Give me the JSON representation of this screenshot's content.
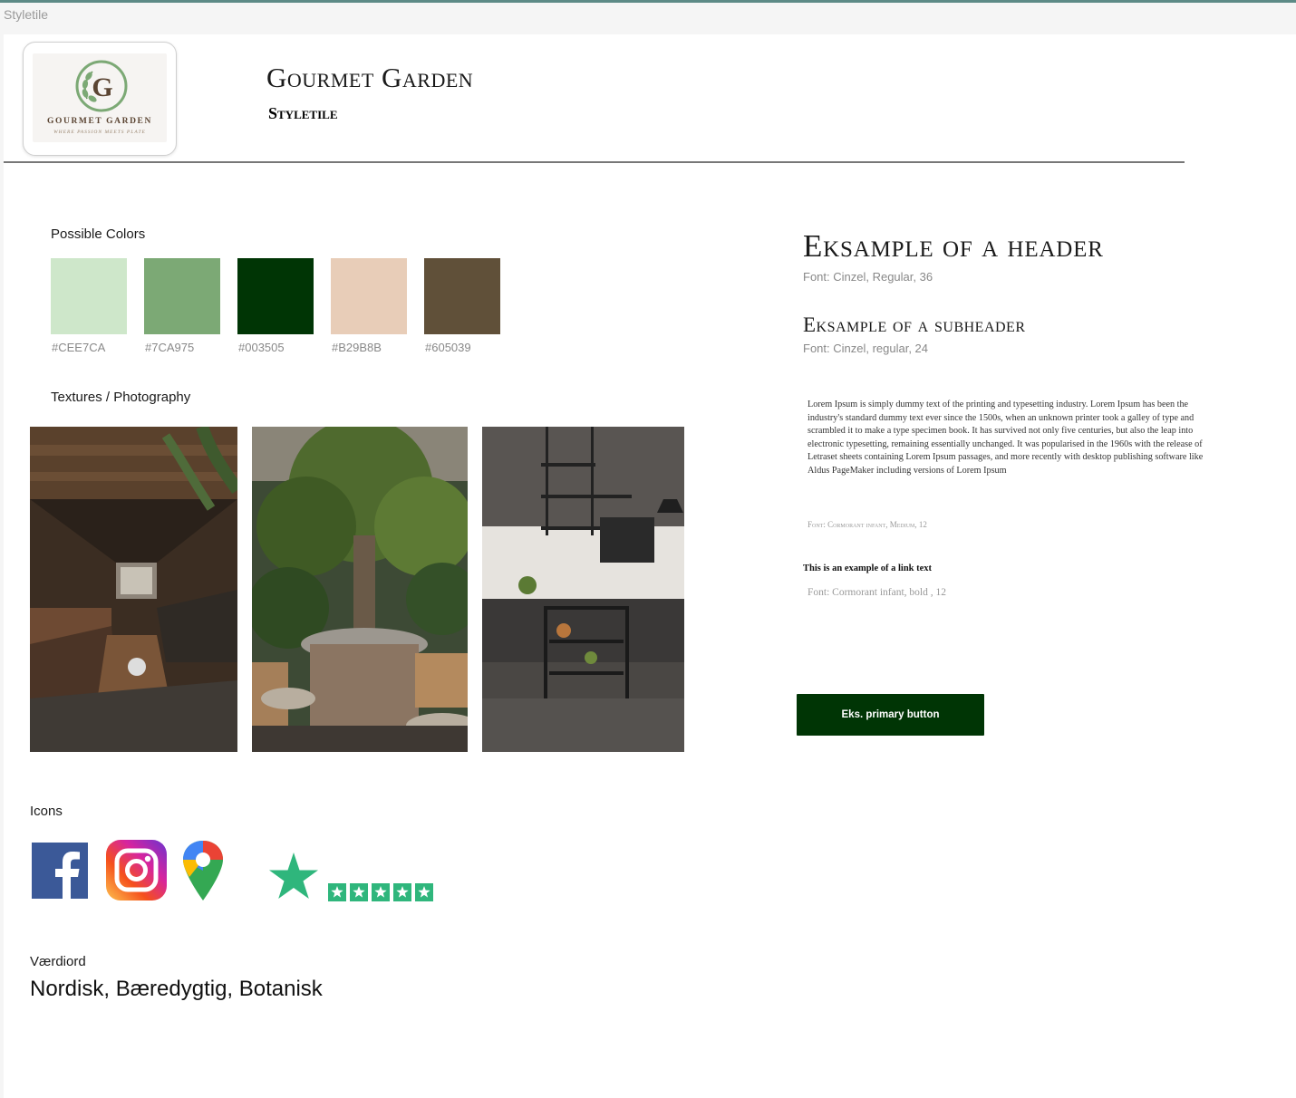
{
  "window": {
    "frame_label": "Styletile"
  },
  "brand": {
    "title": "Gourmet Garden",
    "subtitle": "Styletile",
    "logo": {
      "monogram": "G",
      "name": "GOURMET GARDEN",
      "tagline": "WHERE PASSION MEETS PLATE"
    }
  },
  "colors": {
    "label": "Possible Colors",
    "swatches": [
      {
        "hex": "#CEE7CA",
        "label": "#CEE7CA"
      },
      {
        "hex": "#7CA975",
        "label": "#7CA975"
      },
      {
        "hex": "#003505",
        "label": "#003505"
      },
      {
        "hex": "#E8CDB8",
        "label": "#B29B8B"
      },
      {
        "hex": "#605039",
        "label": "#605039"
      }
    ]
  },
  "textures": {
    "label": "Textures / Photography",
    "photos": [
      "restaurant-interior-photo",
      "tree-dining-photo",
      "kitchen-photo"
    ]
  },
  "icons": {
    "label": "Icons",
    "items": [
      "facebook-icon",
      "instagram-icon",
      "google-maps-icon",
      "trustpilot-icon"
    ],
    "trustpilot_rating": 5
  },
  "values": {
    "label": "Værdiord",
    "text": "Nordisk, Bæredygtig, Botanisk"
  },
  "typography": {
    "header": "Eksample of a header",
    "header_meta": "Font: Cinzel, Regular, 36",
    "subheader": "Eksample of a subheader",
    "subheader_meta": "Font: Cinzel, regular, 24",
    "body": "Lorem Ipsum is simply dummy text of the printing and typesetting industry. Lorem Ipsum has been the industry's standard dummy text ever since the 1500s, when an unknown printer took a galley of type and scrambled it to make a type specimen book. It has survived not only five centuries, but also the leap into electronic typesetting, remaining essentially unchanged. It was popularised in the 1960s with the release of Letraset sheets containing Lorem Ipsum passages, and more recently with desktop publishing software like Aldus PageMaker including versions of Lorem Ipsum",
    "body_meta": "Font: Cormorant infant, Medium, 12",
    "link": "This is an example of a link text",
    "link_meta": "Font: Cormorant infant, bold , 12"
  },
  "button": {
    "label": "Eks. primary button",
    "color": "#003505"
  }
}
